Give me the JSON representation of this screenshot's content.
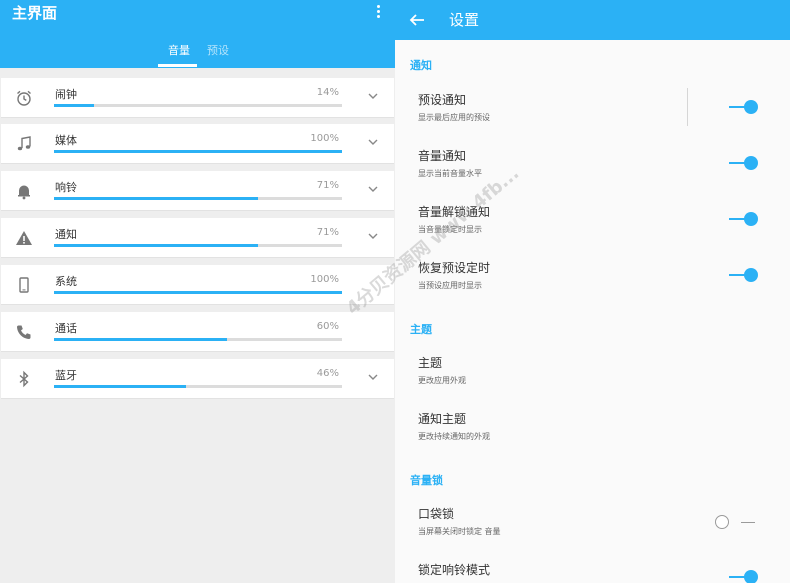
{
  "main": {
    "title": "主界面",
    "tabs": [
      {
        "label": "音量",
        "active": true
      },
      {
        "label": "预设",
        "active": false
      }
    ],
    "volumes": [
      {
        "name": "闹钟",
        "percent": "14%",
        "level": 0.14,
        "icon": "alarm-clock-icon",
        "expandable": true
      },
      {
        "name": "媒体",
        "percent": "100%",
        "level": 1.0,
        "icon": "music-note-icon",
        "expandable": true
      },
      {
        "name": "响铃",
        "percent": "71%",
        "level": 0.71,
        "icon": "bell-icon",
        "expandable": true
      },
      {
        "name": "通知",
        "percent": "71%",
        "level": 0.71,
        "icon": "warning-icon",
        "expandable": true
      },
      {
        "name": "系统",
        "percent": "100%",
        "level": 1.0,
        "icon": "phone-device-icon",
        "expandable": false
      },
      {
        "name": "通话",
        "percent": "60%",
        "level": 0.6,
        "icon": "phone-call-icon",
        "expandable": false
      },
      {
        "name": "蓝牙",
        "percent": "46%",
        "level": 0.46,
        "icon": "bluetooth-icon",
        "expandable": true
      }
    ]
  },
  "settings": {
    "title": "设置",
    "sections": {
      "notification": "通知",
      "theme": "主题",
      "volume_lock": "音量锁"
    },
    "items": [
      {
        "title": "预设通知",
        "desc": "显示最后应用的预设",
        "toggle": true
      },
      {
        "title": "音量通知",
        "desc": "显示当前音量水平",
        "toggle": true
      },
      {
        "title": "音量解锁通知",
        "desc": "当音量锁定时显示",
        "toggle": true
      },
      {
        "title": "恢复预设定时",
        "desc": "当预设应用时显示",
        "toggle": true
      },
      {
        "title": "主题",
        "desc": "更改应用外观"
      },
      {
        "title": "通知主题",
        "desc": "更改持续通知的外观"
      },
      {
        "title": "口袋锁",
        "desc": "当屏幕关闭时锁定 音量",
        "toggle": false
      },
      {
        "title": "锁定响铃模式",
        "toggle": true
      }
    ]
  },
  "watermark": "4分贝资源网 www.4fb..."
}
